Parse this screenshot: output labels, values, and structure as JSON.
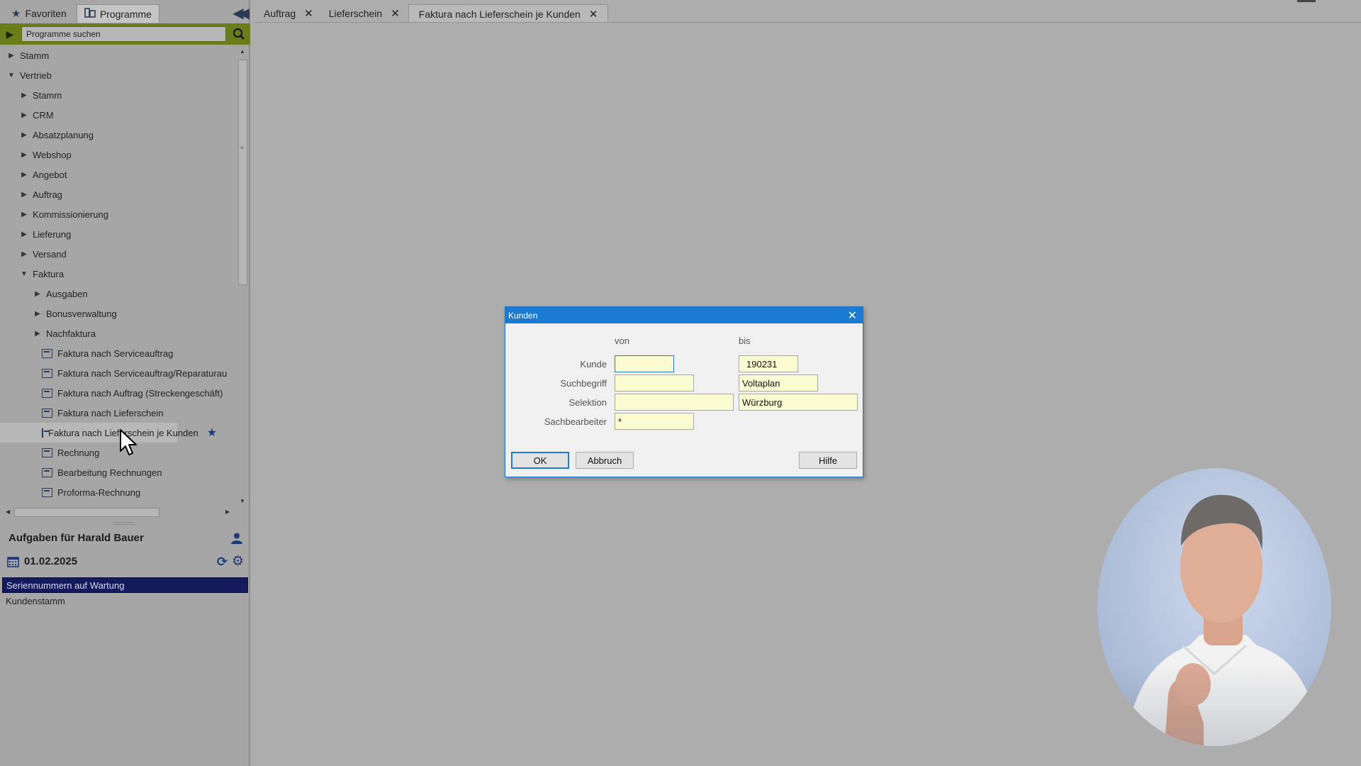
{
  "left_tabs": [
    {
      "label": "Favoriten",
      "icon": "star-icon"
    },
    {
      "label": "Programme",
      "icon": "programs-icon",
      "active": true
    }
  ],
  "search": {
    "placeholder": "Programme suchen"
  },
  "tree": [
    {
      "label": "Stamm",
      "level": 0,
      "toggle": "collapsed"
    },
    {
      "label": "Vertrieb",
      "level": 0,
      "toggle": "expanded"
    },
    {
      "label": "Stamm",
      "level": 1,
      "toggle": "collapsed"
    },
    {
      "label": "CRM",
      "level": 1,
      "toggle": "collapsed"
    },
    {
      "label": "Absatzplanung",
      "level": 1,
      "toggle": "collapsed"
    },
    {
      "label": "Webshop",
      "level": 1,
      "toggle": "collapsed"
    },
    {
      "label": "Angebot",
      "level": 1,
      "toggle": "collapsed"
    },
    {
      "label": "Auftrag",
      "level": 1,
      "toggle": "collapsed"
    },
    {
      "label": "Kommissionierung",
      "level": 1,
      "toggle": "collapsed"
    },
    {
      "label": "Lieferung",
      "level": 1,
      "toggle": "collapsed"
    },
    {
      "label": "Versand",
      "level": 1,
      "toggle": "collapsed"
    },
    {
      "label": "Faktura",
      "level": 1,
      "toggle": "expanded"
    },
    {
      "label": "Ausgaben",
      "level": 2,
      "toggle": "collapsed"
    },
    {
      "label": "Bonusverwaltung",
      "level": 2,
      "toggle": "collapsed"
    },
    {
      "label": "Nachfaktura",
      "level": 2,
      "toggle": "collapsed"
    },
    {
      "label": "Faktura nach Serviceauftrag",
      "level": 2,
      "toggle": "leaf"
    },
    {
      "label": "Faktura nach Serviceauftrag/Reparaturau",
      "level": 2,
      "toggle": "leaf"
    },
    {
      "label": "Faktura nach Auftrag (Streckengeschäft)",
      "level": 2,
      "toggle": "leaf"
    },
    {
      "label": "Faktura nach Lieferschein",
      "level": 2,
      "toggle": "leaf"
    },
    {
      "label": "Faktura nach Lieferschein je Kunden",
      "level": 2,
      "toggle": "leaf",
      "hover": true,
      "favorite": true
    },
    {
      "label": "Rechnung",
      "level": 2,
      "toggle": "leaf"
    },
    {
      "label": "Bearbeitung Rechnungen",
      "level": 2,
      "toggle": "leaf"
    },
    {
      "label": "Proforma-Rechnung",
      "level": 2,
      "toggle": "leaf"
    }
  ],
  "tasks": {
    "title": "Aufgaben für Harald Bauer",
    "date": "01.02.2025",
    "items": [
      {
        "label": "Seriennummern auf Wartung",
        "selected": true
      },
      {
        "label": "Kundenstamm",
        "selected": false
      }
    ]
  },
  "main_tabs": [
    {
      "label": "Auftrag",
      "closable": true
    },
    {
      "label": "Lieferschein",
      "closable": true
    },
    {
      "label": "Faktura nach Lieferschein je Kunden",
      "closable": true,
      "active": true
    }
  ],
  "dialog": {
    "title": "Kunden",
    "col_from": "von",
    "col_to": "bis",
    "fields": {
      "kunde": {
        "label": "Kunde",
        "from": "",
        "to": "190231"
      },
      "suchbegriff": {
        "label": "Suchbegriff",
        "from": "",
        "to": "Voltaplan"
      },
      "selektion": {
        "label": "Selektion",
        "from": "",
        "to": "Würzburg"
      },
      "sachbearbeiter": {
        "label": "Sachbearbeiter",
        "from": "*"
      }
    },
    "buttons": {
      "ok": "OK",
      "cancel": "Abbruch",
      "help": "Hilfe"
    }
  },
  "colors": {
    "search_bar": "#6a7d1a",
    "dialog_title": "#1b7ad2",
    "task_selected": "#151a5c",
    "icon_blue": "#1f3a78"
  }
}
